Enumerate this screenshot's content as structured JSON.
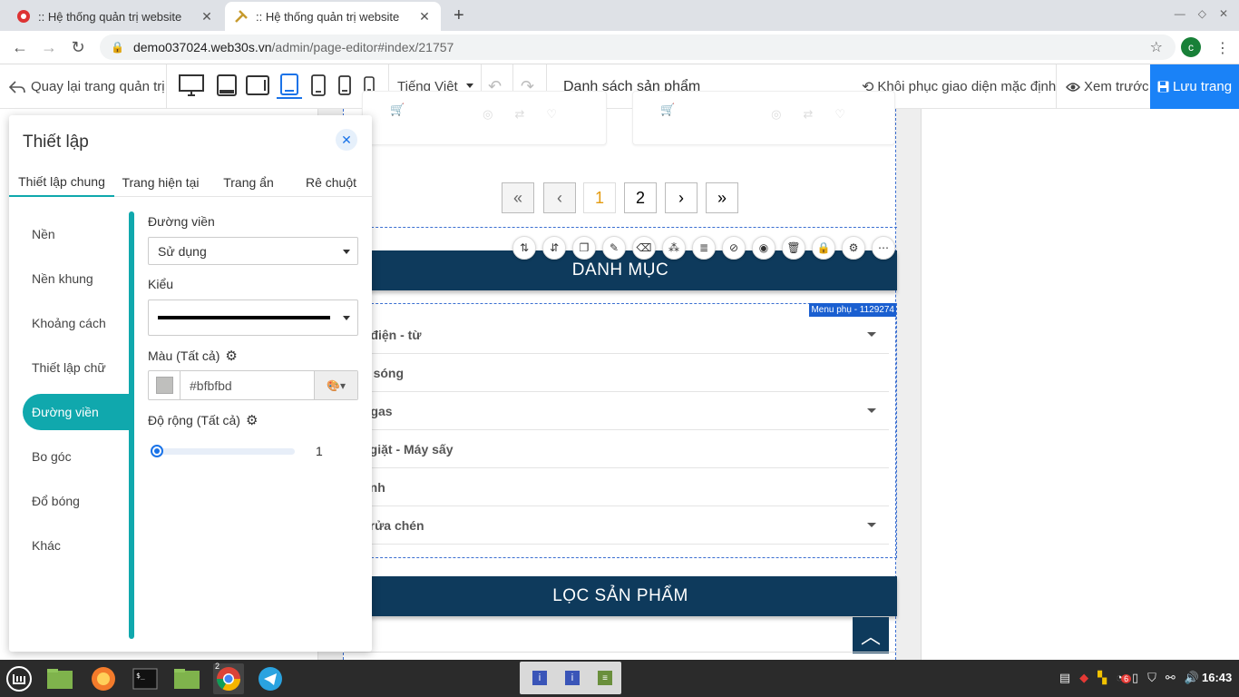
{
  "browser": {
    "tabs": [
      {
        "title": ":: Hệ thống quản trị website",
        "active": false
      },
      {
        "title": ":: Hệ thống quản trị website",
        "active": true
      }
    ],
    "url_domain": "demo037024.web30s.vn",
    "url_path": "/admin/page-editor#index/21757",
    "profile_initial": "c"
  },
  "editor": {
    "back_label": "Quay lại trang quản trị",
    "language": "Tiếng Việt",
    "page_name": "Danh sách sản phẩm",
    "restore_label": "Khôi phục giao diện mặc định",
    "preview_label": "Xem trước",
    "save_label": "Lưu trang"
  },
  "panel": {
    "title": "Thiết lập",
    "tabs": [
      "Thiết lập chung",
      "Trang hiện tại",
      "Trang ẩn",
      "Rê chuột"
    ],
    "side_items": [
      "Nền",
      "Nền khung",
      "Khoảng cách",
      "Thiết lập chữ",
      "Đường viền",
      "Bo góc",
      "Đổ bóng",
      "Khác"
    ],
    "active_side_item": "Đường viền",
    "border_label": "Đường viền",
    "border_value": "Sử dụng",
    "style_label": "Kiểu",
    "color_label": "Màu (Tất cả)",
    "color_value": "#bfbfbd",
    "width_label": "Độ rộng (Tất cả)",
    "width_value": "1"
  },
  "canvas": {
    "pagination": [
      "1",
      "2"
    ],
    "current_page": "1",
    "banner_category": "DANH MỤC",
    "menu_tag": "Menu phụ - 1129274",
    "menu_items": [
      {
        "label": "o điện - từ",
        "has_children": true
      },
      {
        "label": "vi sóng",
        "has_children": false
      },
      {
        "label": "o gas",
        "has_children": true
      },
      {
        "label": "y giặt - Máy sấy",
        "has_children": false
      },
      {
        "label": "lạnh",
        "has_children": false
      },
      {
        "label": "y rửa chén",
        "has_children": true
      }
    ],
    "banner_filter": "LỌC SẢN PHẨM"
  },
  "taskbar": {
    "chrome_badge": "2",
    "notify_badge": "6",
    "clock": "16:43"
  },
  "colors": {
    "accent": "#10a8ad",
    "save_button": "#1a82f7",
    "banner": "#0e3a5c",
    "swatch": "#bfbfbd"
  }
}
